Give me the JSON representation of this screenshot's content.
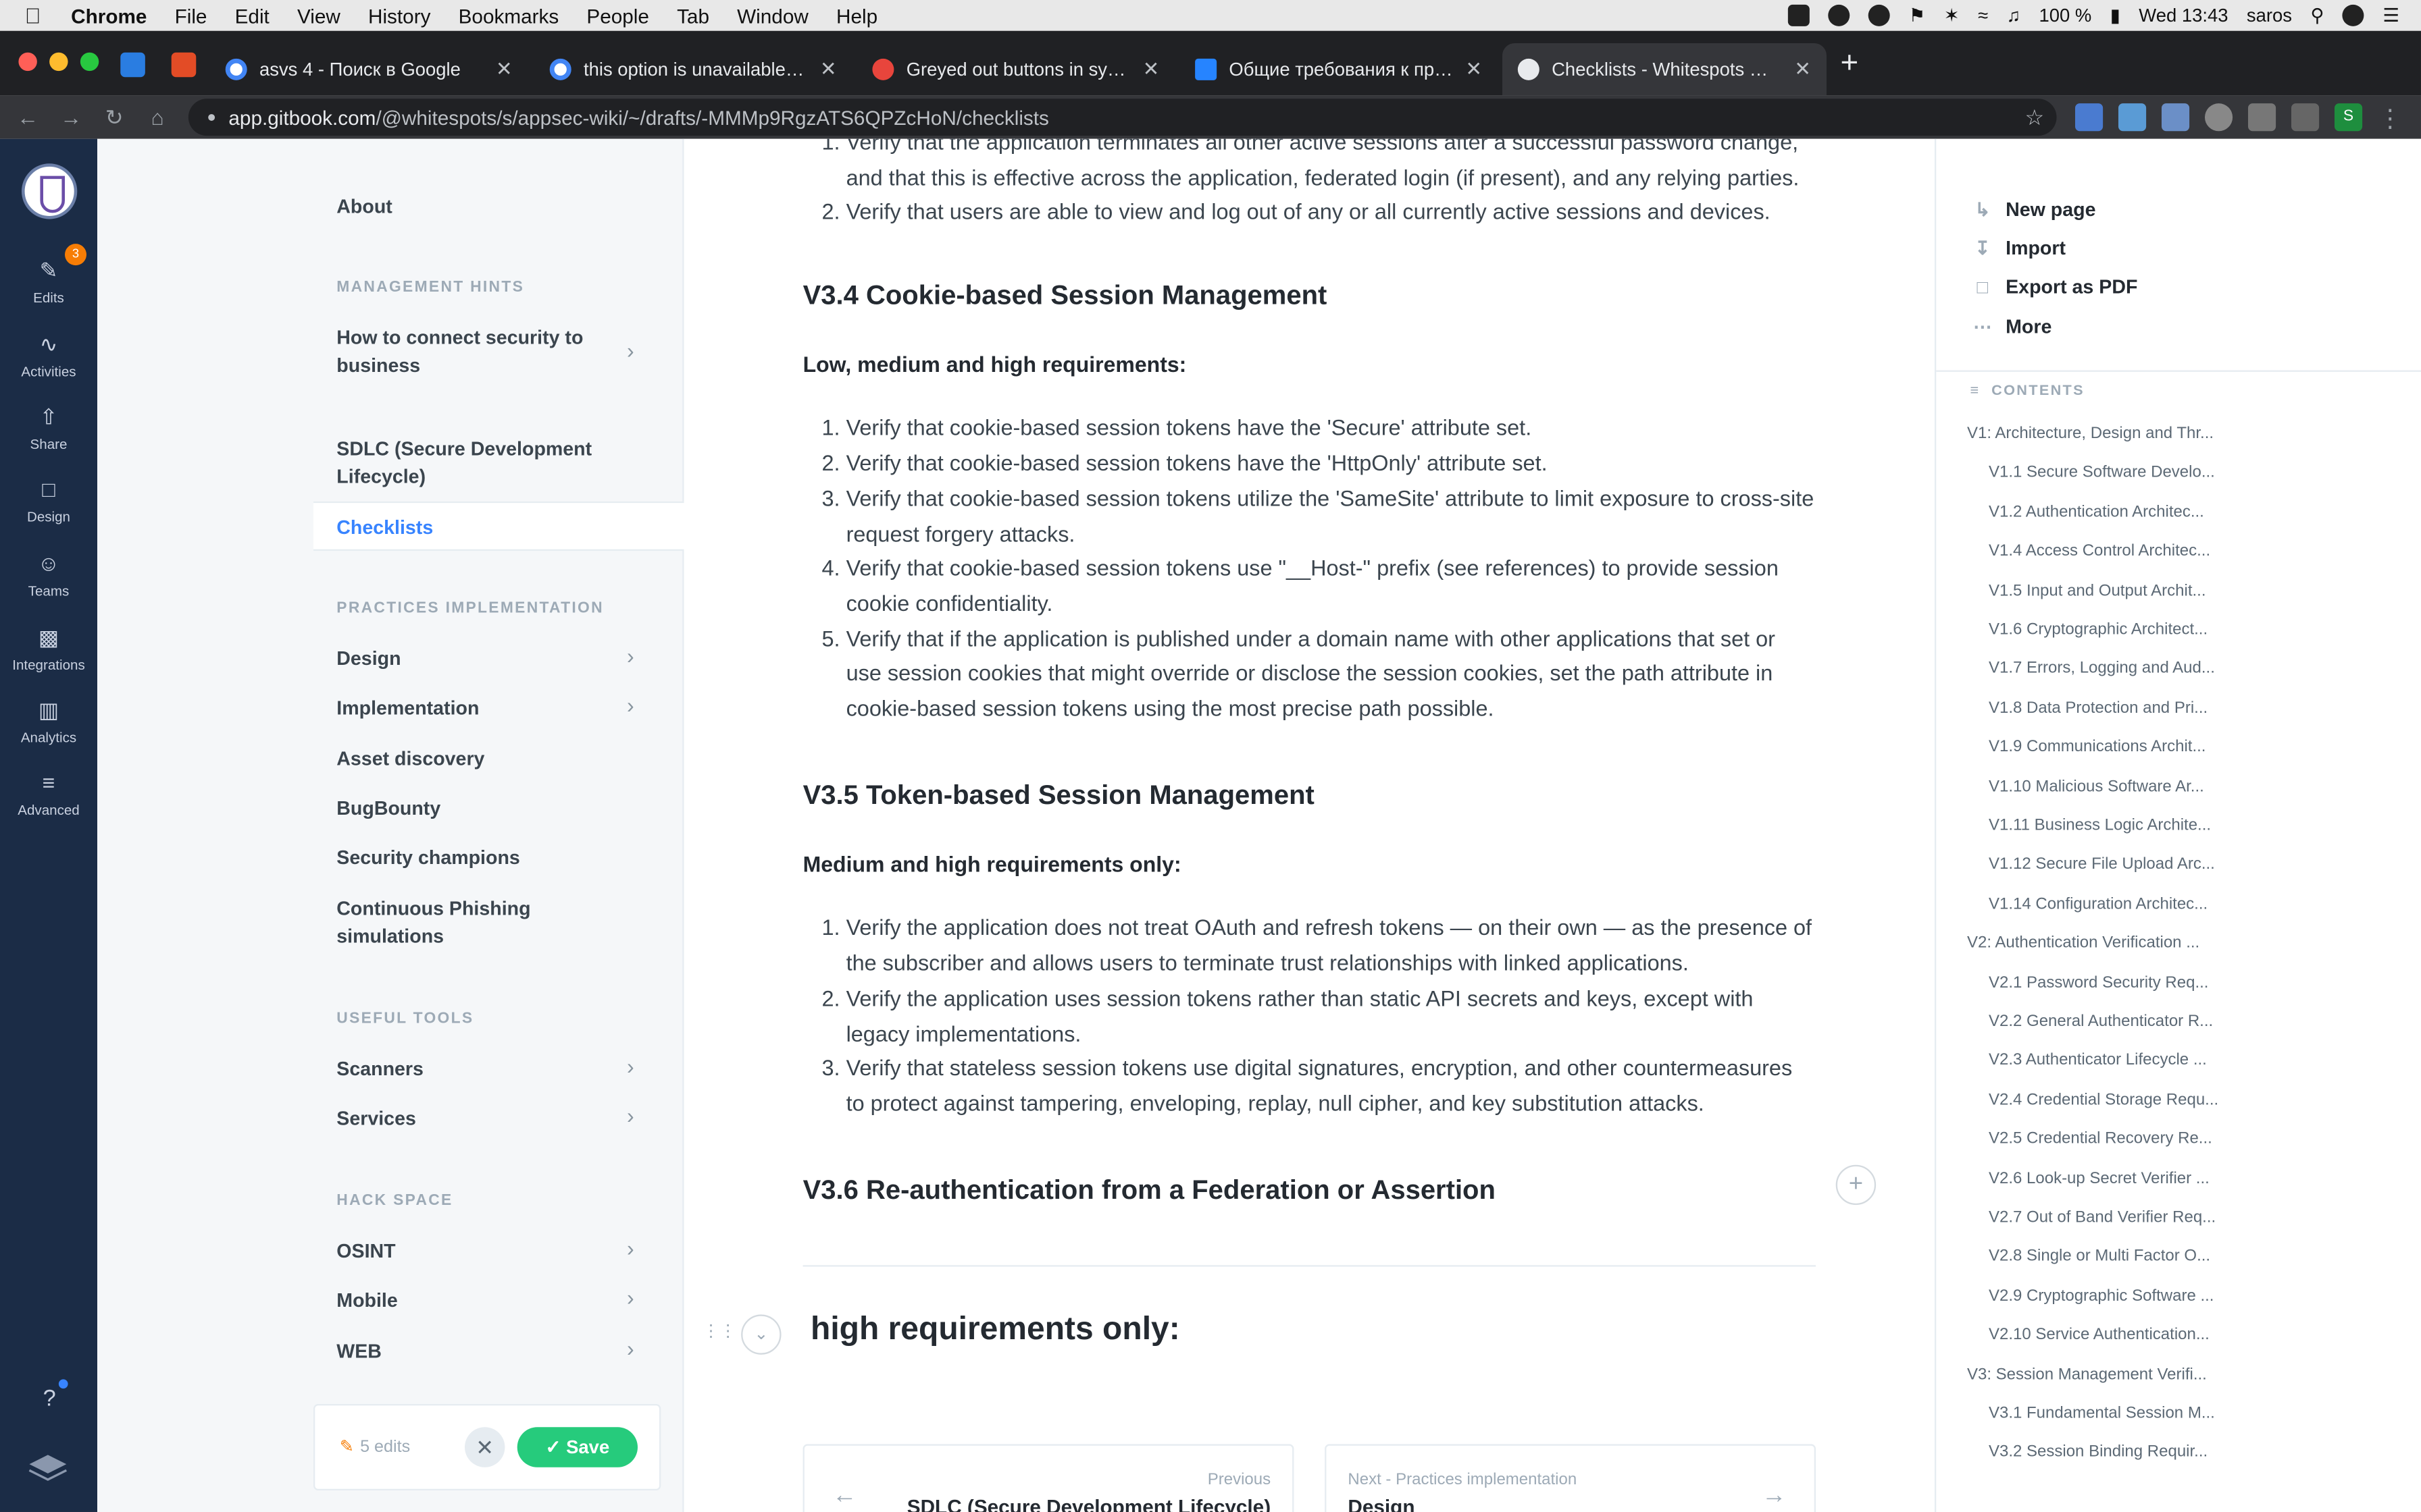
{
  "menubar": {
    "app": "Chrome",
    "items": [
      "File",
      "Edit",
      "View",
      "History",
      "Bookmarks",
      "People",
      "Tab",
      "Window",
      "Help"
    ],
    "battery": "100 %",
    "clock": "Wed 13:43",
    "user": "saros"
  },
  "tabs": [
    {
      "title": "asvs 4 - Поиск в Google",
      "favicon_color": "#4285f4"
    },
    {
      "title": "this option is unavailable beca",
      "favicon_color": "#4285f4"
    },
    {
      "title": "Greyed out buttons in system p",
      "favicon_color": "#e8453c"
    },
    {
      "title": "Общие требования к приложе",
      "favicon_color": "#2684ff"
    },
    {
      "title": "Checklists - Whitespots Wiki",
      "favicon_color": "#e8eaed"
    }
  ],
  "address_bar": {
    "host": "app.gitbook.com",
    "path": "/@whitespots/s/appsec-wiki/~/drafts/-MMMp9RgzATS6QPZcHoN/checklists"
  },
  "rail": {
    "edits_badge": "3",
    "items": [
      "Edits",
      "Activities",
      "Share",
      "Design",
      "Teams",
      "Integrations",
      "Analytics",
      "Advanced"
    ],
    "help": "?"
  },
  "sidenav": {
    "about": "About",
    "management_hints": "MANAGEMENT HINTS",
    "connect": "How to connect security to business",
    "sdlc": "SDLC (Secure Development Lifecycle)",
    "checklists": "Checklists",
    "practices": "PRACTICES IMPLEMENTATION",
    "design": "Design",
    "implementation": "Implementation",
    "asset": "Asset discovery",
    "bugbounty": "BugBounty",
    "champions": "Security champions",
    "phishing": "Continuous Phishing simulations",
    "useful": "USEFUL TOOLS",
    "scanners": "Scanners",
    "services": "Services",
    "hack": "HACK SPACE",
    "osint": "OSINT",
    "mobile": "Mobile",
    "web": "WEB",
    "edits_count": "5 edits",
    "save": "Save"
  },
  "content": {
    "top_items": [
      "Verify that the application terminates all other active sessions after a successful password change, and that this is effective across the application, federated login (if present), and any relying parties.",
      "Verify that users are able to view and log out of any or all currently active sessions and devices."
    ],
    "v34_title": "V3.4 Cookie-based Session Management",
    "v34_req": "Low, medium and high requirements:",
    "v34_items": [
      "Verify that cookie-based session tokens have the 'Secure' attribute set.",
      "Verify that cookie-based session tokens have the 'HttpOnly' attribute set.",
      "Verify that cookie-based session tokens utilize the 'SameSite' attribute to limit exposure to cross-site request forgery attacks.",
      "Verify that cookie-based session tokens use \"__Host-\" prefix (see references) to provide session cookie confidentiality.",
      "Verify that if the application is published under a domain name with other applications that set or use session cookies that might override or disclose the session cookies, set the path attribute in cookie-based session tokens using the most precise path possible."
    ],
    "v35_title": "V3.5 Token-based Session Management",
    "v35_req": "Medium and high requirements only:",
    "v35_items": [
      "Verify the application does not treat OAuth and refresh tokens — on their own — as the presence of the subscriber and allows users to terminate trust relationships with linked applications.",
      "Verify the application uses session tokens rather than static API secrets and keys, except with legacy implementations.",
      "Verify that stateless session tokens use digital signatures, encryption, and other countermeasures to protect against tampering, enveloping, replay, null cipher, and key substitution attacks."
    ],
    "v36_title": "V3.6 Re-authentication from a Federation or Assertion",
    "big_heading": "high requirements only:",
    "prev_label": "Previous",
    "prev_title": "SDLC (Secure Development Lifecycle)",
    "next_label": "Next - Practices implementation",
    "next_title": "Design"
  },
  "rpanel": {
    "new_page": "New page",
    "import": "Import",
    "export": "Export as PDF",
    "more": "More",
    "contents": "CONTENTS",
    "toc": [
      {
        "label": "V1: Architecture, Design and Thr...",
        "level": 0
      },
      {
        "label": "V1.1 Secure Software Develo...",
        "level": 1
      },
      {
        "label": "V1.2 Authentication Architec...",
        "level": 1
      },
      {
        "label": "V1.4 Access Control Architec...",
        "level": 1
      },
      {
        "label": "V1.5 Input and Output Archit...",
        "level": 1
      },
      {
        "label": "V1.6 Cryptographic Architect...",
        "level": 1
      },
      {
        "label": "V1.7 Errors, Logging and Aud...",
        "level": 1
      },
      {
        "label": "V1.8 Data Protection and Pri...",
        "level": 1
      },
      {
        "label": "V1.9 Communications Archit...",
        "level": 1
      },
      {
        "label": "V1.10 Malicious Software Ar...",
        "level": 1
      },
      {
        "label": "V1.11 Business Logic Archite...",
        "level": 1
      },
      {
        "label": "V1.12 Secure File Upload Arc...",
        "level": 1
      },
      {
        "label": "V1.14 Configuration Architec...",
        "level": 1
      },
      {
        "label": "V2: Authentication Verification ...",
        "level": 0
      },
      {
        "label": "V2.1 Password Security Req...",
        "level": 1
      },
      {
        "label": "V2.2 General Authenticator R...",
        "level": 1
      },
      {
        "label": "V2.3 Authenticator Lifecycle ...",
        "level": 1
      },
      {
        "label": "V2.4 Credential Storage Requ...",
        "level": 1
      },
      {
        "label": "V2.5 Credential Recovery Re...",
        "level": 1
      },
      {
        "label": "V2.6 Look-up Secret Verifier ...",
        "level": 1
      },
      {
        "label": "V2.7 Out of Band Verifier Req...",
        "level": 1
      },
      {
        "label": "V2.8 Single or Multi Factor O...",
        "level": 1
      },
      {
        "label": "V2.9 Cryptographic Software ...",
        "level": 1
      },
      {
        "label": "V2.10 Service Authentication...",
        "level": 1
      },
      {
        "label": "V3: Session Management Verifi...",
        "level": 0
      },
      {
        "label": "V3.1 Fundamental Session M...",
        "level": 1
      },
      {
        "label": "V3.2 Session Binding Requir...",
        "level": 1
      }
    ]
  },
  "colors": {
    "accent": "#3884ff",
    "save": "#26cb7c",
    "rail": "#1b2c46",
    "badge": "#f77d05"
  }
}
